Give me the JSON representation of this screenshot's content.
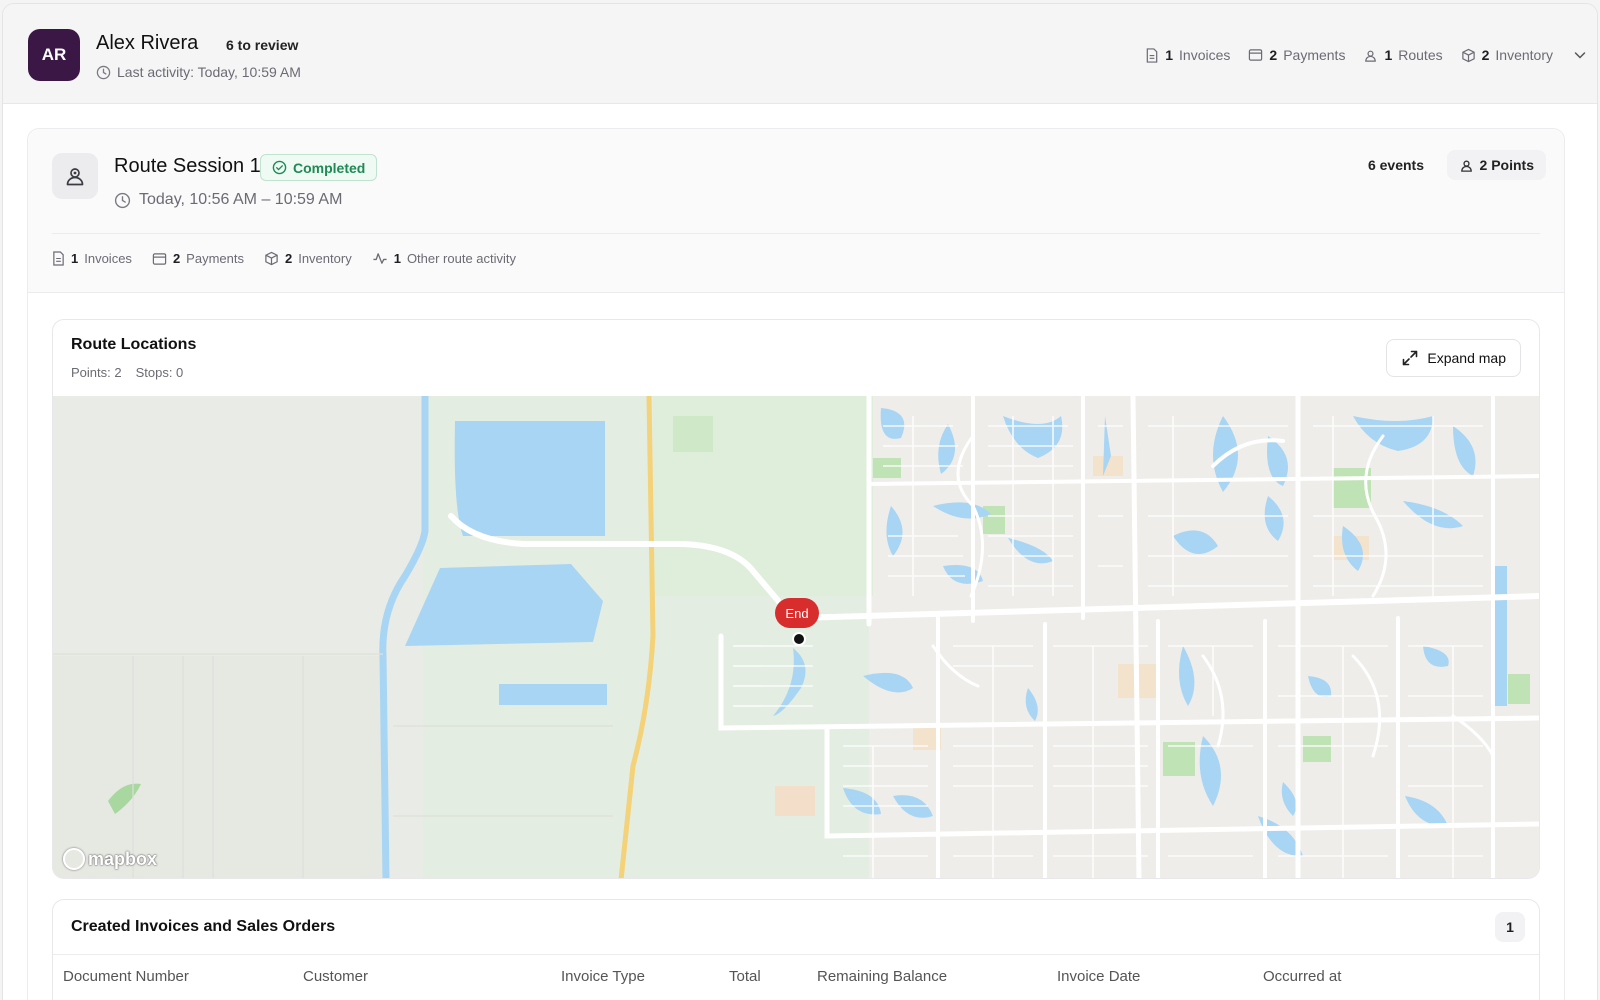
{
  "user": {
    "initials": "AR",
    "name": "Alex Rivera",
    "review_badge": "6 to review",
    "last_activity": "Last activity: Today, 10:59 AM"
  },
  "summary": [
    {
      "icon": "document-icon",
      "count": "1",
      "label": "Invoices"
    },
    {
      "icon": "payment-icon",
      "count": "2",
      "label": "Payments"
    },
    {
      "icon": "route-icon",
      "count": "1",
      "label": "Routes"
    },
    {
      "icon": "package-icon",
      "count": "2",
      "label": "Inventory"
    }
  ],
  "session": {
    "title": "Route Session 1",
    "status": "Completed",
    "time_range": "Today, 10:56 AM – 10:59 AM",
    "events": "6 events",
    "points": "2 Points",
    "stats": [
      {
        "icon": "document-icon",
        "count": "1",
        "label": "Invoices"
      },
      {
        "icon": "payment-icon",
        "count": "2",
        "label": "Payments"
      },
      {
        "icon": "package-icon",
        "count": "2",
        "label": "Inventory"
      },
      {
        "icon": "activity-icon",
        "count": "1",
        "label": "Other route activity"
      }
    ]
  },
  "map": {
    "title": "Route Locations",
    "points_label": "Points: 2",
    "stops_label": "Stops: 0",
    "expand_label": "Expand map",
    "marker_label": "End",
    "attribution": "mapbox"
  },
  "invoices": {
    "title": "Created Invoices and Sales Orders",
    "count": "1",
    "columns": [
      "Document Number",
      "Customer",
      "Invoice Type",
      "Total",
      "Remaining Balance",
      "Invoice Date",
      "Occurred at"
    ]
  },
  "colors": {
    "avatar": "#3b1746",
    "status_green": "#1f8a55",
    "marker_red": "#d72d2d",
    "water": "#a8d5f3"
  }
}
